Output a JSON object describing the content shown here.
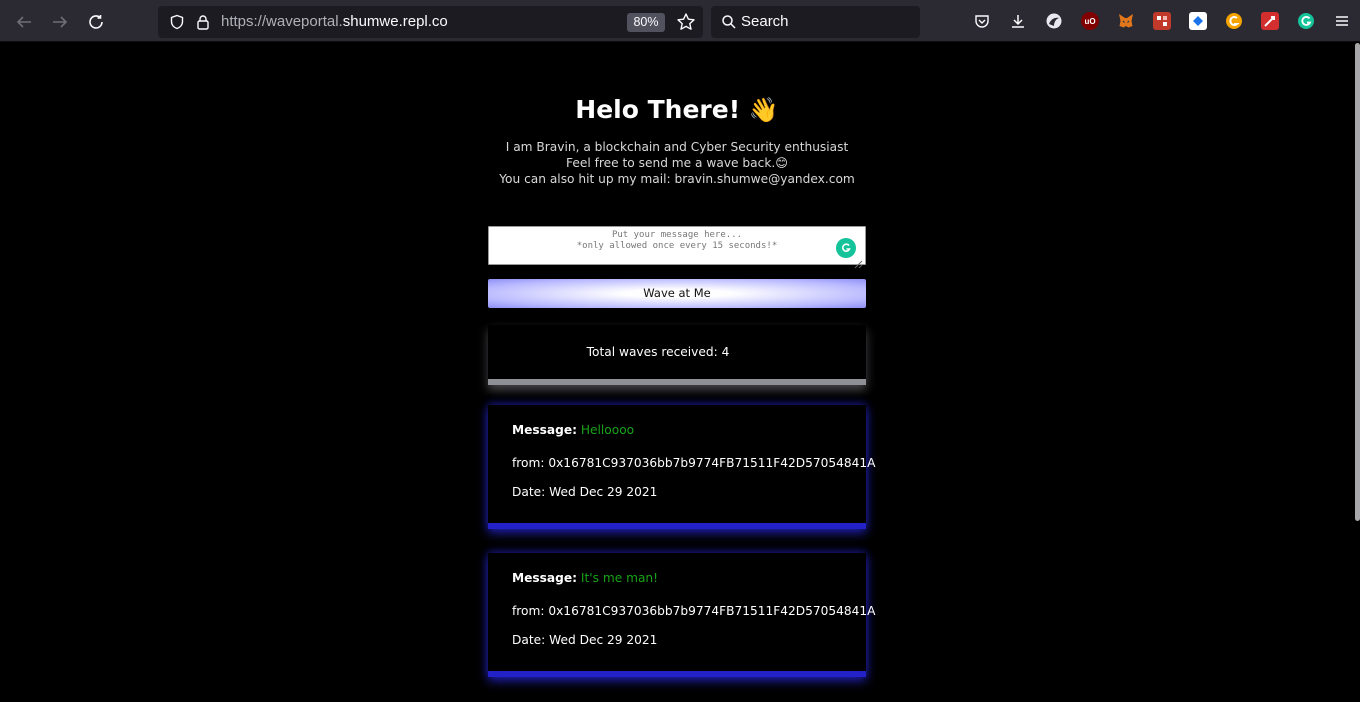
{
  "browser": {
    "url_light": "https://waveportal.",
    "url_domain": "shumwe.repl.co",
    "zoom": "80%",
    "search_placeholder": "Search",
    "extensions": [
      "pocket-icon",
      "downloads-icon",
      "proxy-icon",
      "ublock-icon",
      "metamask-icon",
      "extension-icon",
      "extension-icon",
      "extension-icon",
      "extension-icon",
      "grammarly-icon"
    ]
  },
  "page": {
    "title": "Helo There!",
    "title_emoji": "👋",
    "bio": {
      "line1": "I am Bravin, a blockchain and Cyber Security enthusiast",
      "line2": "Feel free to send me a wave back.😊",
      "line3": "You can also hit up my mail: bravin.shumwe@yandex.com"
    },
    "message_placeholder": "Put your message here...\n*only allowed once every 15 seconds!*",
    "wave_button": "Wave at Me",
    "total_waves": "Total waves received: 4",
    "labels": {
      "message": "Message:",
      "from": "from:",
      "date": "Date:"
    },
    "waves": [
      {
        "message": "Helloooo",
        "from": "0x16781C937036bb7b9774FB71511F42D57054841A",
        "date": "Wed Dec 29 2021"
      },
      {
        "message": "It's me man!",
        "from": "0x16781C937036bb7b9774FB71511F42D57054841A",
        "date": "Wed Dec 29 2021"
      }
    ]
  },
  "colors": {
    "background": "#000000",
    "message_text": "#18a318",
    "card_glow": "#2222c8"
  }
}
